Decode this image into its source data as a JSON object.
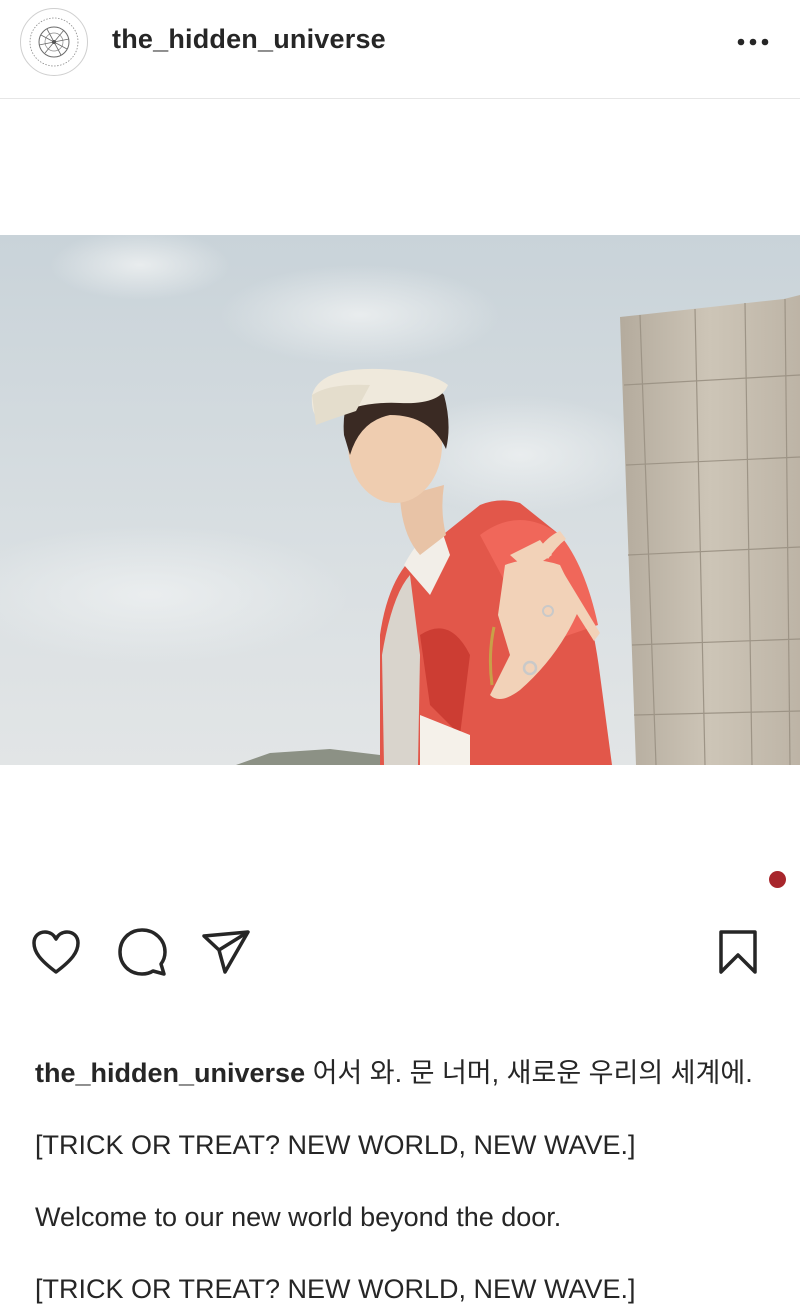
{
  "header": {
    "username": "the_hidden_universe",
    "avatar_icon": "constellation-logo-icon",
    "more_icon": "more-horizontal-icon"
  },
  "post": {
    "photo_alt": "Young man in a white cap and red shirt reaching his hand toward the camera against a cloudy sky beside a concrete tower",
    "carousel_indicator_color": "#a8262c"
  },
  "actions": {
    "like_icon": "heart-icon",
    "comment_icon": "comment-icon",
    "share_icon": "paper-plane-icon",
    "save_icon": "bookmark-icon"
  },
  "caption": {
    "username": "the_hidden_universe",
    "text_line1": " 어서 와. 문 너머, 새로운 우리의 세계에.",
    "line2": "[TRICK OR TREAT? NEW WORLD, NEW WAVE.]",
    "line3": "Welcome to our new world beyond the door.",
    "line4": "[TRICK OR TREAT? NEW WORLD, NEW WAVE.]"
  }
}
